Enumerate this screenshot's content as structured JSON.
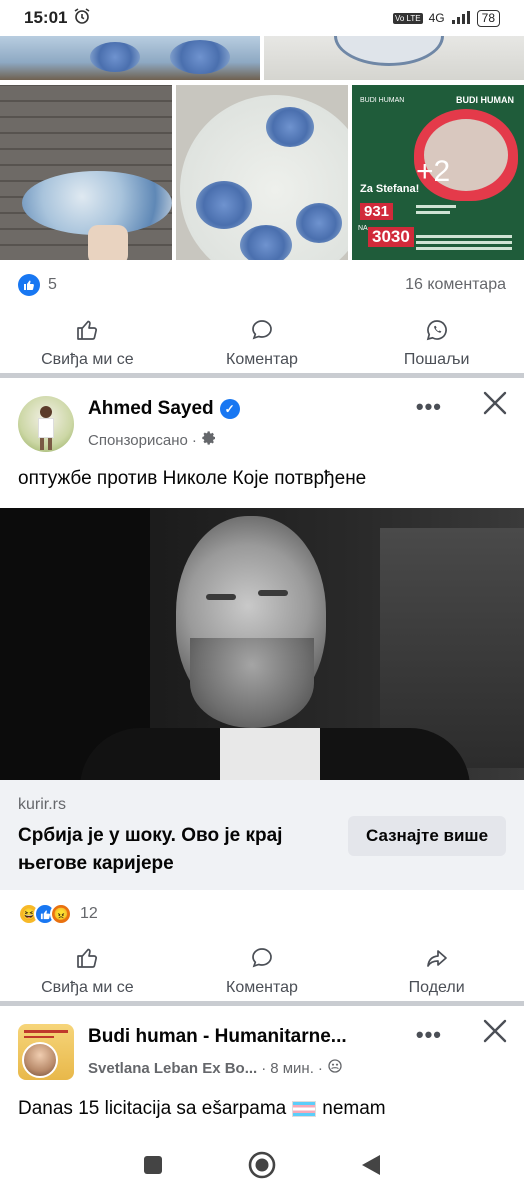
{
  "status_bar": {
    "time": "15:01",
    "alarm_icon": "alarm-icon",
    "network": "4G",
    "volte": "Vo LTE",
    "battery": "78"
  },
  "post1": {
    "extra_photos": "+2",
    "fundraiser": {
      "org": "BUDI HUMAN",
      "logo_text": "BUDI HUMAN",
      "for": "Za Stefana!",
      "sms_number": "931",
      "na": "NA",
      "sms_target": "3030"
    },
    "like_count": "5",
    "comment_count": "16 коментара",
    "actions": {
      "like": "Свиђа ми се",
      "comment": "Коментар",
      "send": "Пошаљи"
    }
  },
  "post2": {
    "author": "Ahmed Sayed",
    "sponsored": "Спонзорисано",
    "dot": "·",
    "text": "оптужбе против Николе Које потврђене",
    "link": {
      "domain": "kurir.rs",
      "title": "Србија је у шоку. Ово је крај његове каријере",
      "cta": "Сазнајте више"
    },
    "reaction_count": "12",
    "actions": {
      "like": "Свиђа ми се",
      "comment": "Коментар",
      "share": "Подели"
    }
  },
  "post3": {
    "group": "Budi human - Humanitarne...",
    "author": "Svetlana Leban Ex Bo...",
    "dot": "·",
    "time": "8 мин.",
    "dot2": "·",
    "text": "Danas 15 licitacija sa ešarpama",
    "text_after": "nemam"
  },
  "icons": {
    "like": "thumbs-up-icon",
    "comment": "comment-icon",
    "send": "whatsapp-icon",
    "share": "share-icon",
    "more": "more-icon",
    "close": "close-icon",
    "settings": "gear-icon",
    "audience": "friends-icon"
  },
  "colors": {
    "accent": "#1877f2",
    "divider": "#c9ccd1",
    "link_bg": "#f0f2f5",
    "muted": "#65676b"
  }
}
